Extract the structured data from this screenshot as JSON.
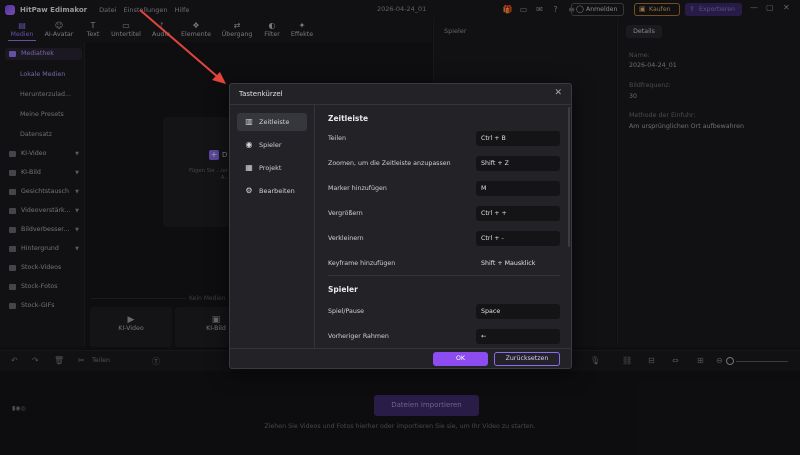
{
  "app": {
    "name": "HitPaw Edimakor",
    "menu": [
      "Datei",
      "Einstellungen",
      "Hilfe"
    ],
    "project_date": "2026-04-24_01",
    "login_label": "Anmelden",
    "buy_label": "Kaufen",
    "export_label": "Exportieren"
  },
  "toolbar": {
    "tools": [
      {
        "label": "Medien",
        "icon": "media-icon",
        "active": true
      },
      {
        "label": "AI-Avatar",
        "icon": "avatar-icon"
      },
      {
        "label": "Text",
        "icon": "text-icon"
      },
      {
        "label": "Untertitel",
        "icon": "subtitle-icon"
      },
      {
        "label": "Audio",
        "icon": "audio-icon"
      },
      {
        "label": "Elemente",
        "icon": "elements-icon"
      },
      {
        "label": "Übergang",
        "icon": "transition-icon"
      },
      {
        "label": "Filter",
        "icon": "filter-icon"
      },
      {
        "label": "Effekte",
        "icon": "effects-icon"
      }
    ]
  },
  "sidebar": {
    "header": "Mediathek",
    "sub_items": [
      "Lokale Medien",
      "Herunterzulad...",
      "Meine Presets",
      "Datensatz"
    ],
    "groups": [
      "KI-Video",
      "KI-Bild",
      "Gesichtstausch",
      "Videoverstärk...",
      "Bildverbesser...",
      "Hintergrund",
      "Stock-Videos",
      "Stock-Fotos",
      "Stock-GIFs"
    ]
  },
  "media": {
    "import_title": "D",
    "import_hint": "Fügen Sie ...ier ... ihr Video, A...",
    "no_media_label": "Kein Medien",
    "cards": [
      "KI-Video",
      "KI-Bild"
    ]
  },
  "preview": {
    "title": "Spieler"
  },
  "details": {
    "tab": "Details",
    "name_label": "Name:",
    "name_value": "2026-04-24_01",
    "fps_label": "Bildfrequenz:",
    "fps_value": "30",
    "method_label": "Methode der Einfuhr:",
    "method_value": "Am ursprünglichen Ort aufbewahren"
  },
  "timeline": {
    "split_label": "Teilen",
    "import_button": "Dateien importieren",
    "hint": "Ziehen Sie Videos und Fotos hierher oder importieren Sie sie, um Ihr Video zu starten."
  },
  "dialog": {
    "title": "Tastenkürzel",
    "nav": [
      {
        "label": "Zeitleiste",
        "icon": "timeline-icon",
        "active": true
      },
      {
        "label": "Spieler",
        "icon": "player-icon"
      },
      {
        "label": "Projekt",
        "icon": "project-icon"
      },
      {
        "label": "Bearbeiten",
        "icon": "edit-icon"
      }
    ],
    "sections": [
      {
        "title": "Zeitleiste",
        "rows": [
          {
            "label": "Teilen",
            "key": "Ctrl + B"
          },
          {
            "label": "Zoomen, um die Zeitleiste anzupassen",
            "key": "Shift + Z"
          },
          {
            "label": "Marker hinzufügen",
            "key": "M"
          },
          {
            "label": "Vergrößern",
            "key": "Ctrl + +"
          },
          {
            "label": "Verkleinern",
            "key": "Ctrl + -"
          },
          {
            "label": "Keyframe hinzufügen",
            "key": "Shift + Mausklick",
            "plain": true
          }
        ]
      },
      {
        "title": "Spieler",
        "rows": [
          {
            "label": "Spiel/Pause",
            "key": "Space"
          },
          {
            "label": "Vorheriger Rahmen",
            "key": "←"
          }
        ]
      }
    ],
    "ok_label": "OK",
    "reset_label": "Zurücksetzen"
  },
  "colors": {
    "accent": "#8c4cf0",
    "annotation_arrow": "#e2453c"
  }
}
